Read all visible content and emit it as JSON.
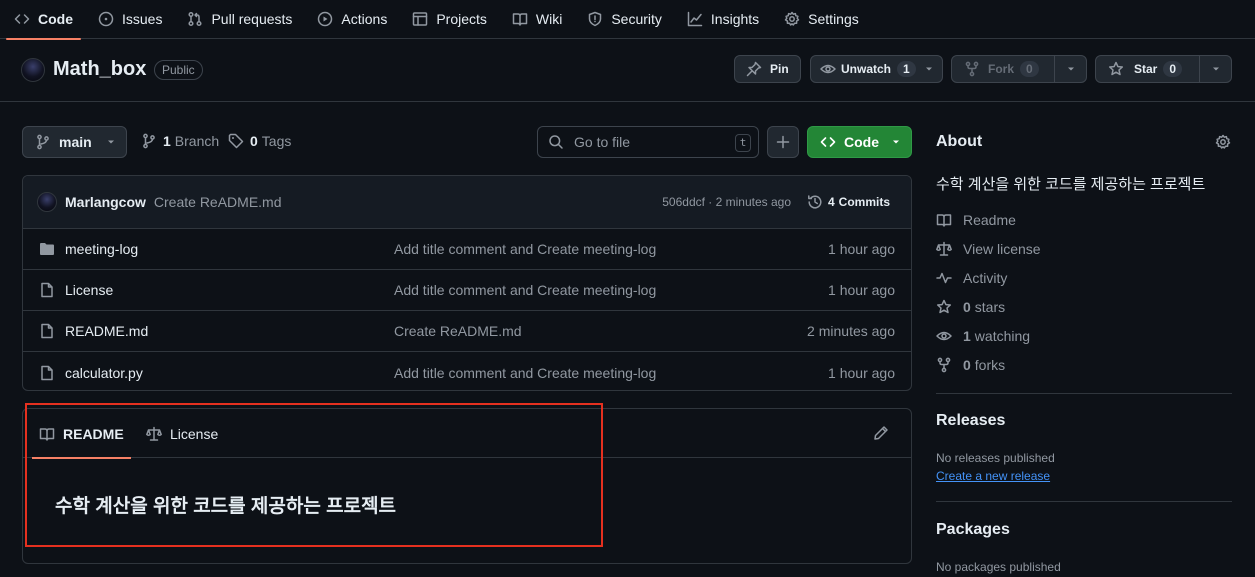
{
  "nav": {
    "tabs": [
      {
        "label": "Code",
        "icon": "code-icon"
      },
      {
        "label": "Issues",
        "icon": "issue-icon"
      },
      {
        "label": "Pull requests",
        "icon": "pull-request-icon"
      },
      {
        "label": "Actions",
        "icon": "play-icon"
      },
      {
        "label": "Projects",
        "icon": "table-icon"
      },
      {
        "label": "Wiki",
        "icon": "book-icon"
      },
      {
        "label": "Security",
        "icon": "shield-icon"
      },
      {
        "label": "Insights",
        "icon": "graph-icon"
      },
      {
        "label": "Settings",
        "icon": "gear-icon"
      }
    ]
  },
  "repo": {
    "name": "Math_box",
    "visibility": "Public",
    "pin_label": "Pin",
    "watch_label": "Unwatch",
    "watch_count": "1",
    "fork_label": "Fork",
    "fork_count": "0",
    "star_label": "Star",
    "star_count": "0"
  },
  "toolbar": {
    "branch": "main",
    "branch_count": "1",
    "branch_label": "Branch",
    "tag_count": "0",
    "tag_label": "Tags",
    "goto_placeholder": "Go to file",
    "goto_shortcut": "t",
    "code_label": "Code"
  },
  "latest_commit": {
    "author": "Marlangcow",
    "message": "Create ReADME.md",
    "hash_time": "506ddcf · 2 minutes ago",
    "commits_count": "4",
    "commits_label": "Commits"
  },
  "files": [
    {
      "name": "meeting-log",
      "type": "folder",
      "message": "Add title comment and Create meeting-log",
      "date": "1 hour ago"
    },
    {
      "name": "License",
      "type": "file",
      "message": "Add title comment and Create meeting-log",
      "date": "1 hour ago"
    },
    {
      "name": "README.md",
      "type": "file",
      "message": "Create ReADME.md",
      "date": "2 minutes ago"
    },
    {
      "name": "calculator.py",
      "type": "file",
      "message": "Add title comment and Create meeting-log",
      "date": "1 hour ago"
    }
  ],
  "readme": {
    "tab_readme": "README",
    "tab_license": "License",
    "heading": "수학 계산을 위한 코드를 제공하는 프로젝트"
  },
  "about": {
    "title": "About",
    "description": "수학 계산을 위한 코드를 제공하는 프로젝트",
    "readme": "Readme",
    "license": "View license",
    "activity": "Activity",
    "stars_count": "0",
    "stars_label": "stars",
    "watching_count": "1",
    "watching_label": "watching",
    "forks_count": "0",
    "forks_label": "forks"
  },
  "releases": {
    "title": "Releases",
    "none": "No releases published",
    "create_link": "Create a new release"
  },
  "packages": {
    "title": "Packages",
    "none": "No packages published"
  },
  "colors": {
    "background": "#0d1117",
    "accent_underline": "#f78166",
    "code_button": "#238636",
    "highlight": "#e5301f",
    "link": "#4493f8"
  }
}
